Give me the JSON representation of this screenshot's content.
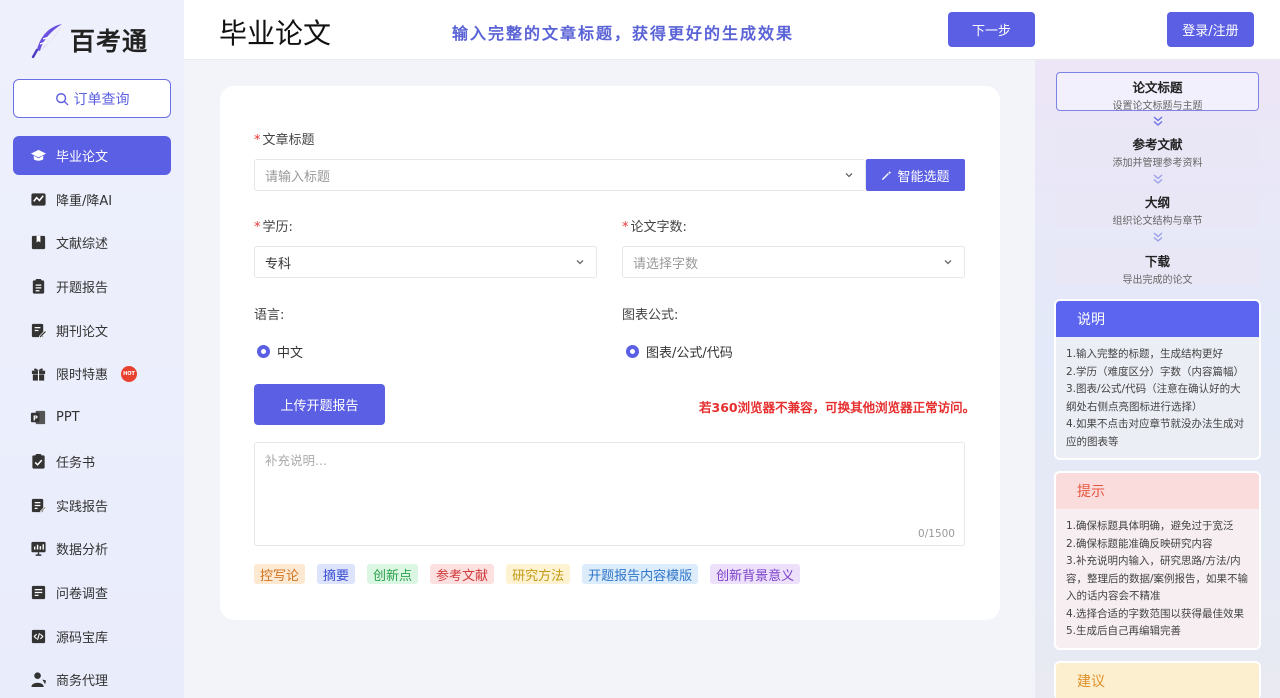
{
  "brand": {
    "name": "百考通"
  },
  "sidebar": {
    "order_query": "订单查询",
    "items": [
      {
        "label": "毕业论文",
        "icon": "graduation-cap-icon",
        "active": true
      },
      {
        "label": "降重/降AI",
        "icon": "chart-wave-icon"
      },
      {
        "label": "文献综述",
        "icon": "book-icon"
      },
      {
        "label": "开题报告",
        "icon": "clipboard-list-icon"
      },
      {
        "label": "期刊论文",
        "icon": "edit-document-icon"
      },
      {
        "label": "限时特惠",
        "icon": "gift-icon",
        "badge": "HOT"
      },
      {
        "label": "PPT",
        "icon": "powerpoint-icon"
      },
      {
        "label": "任务书",
        "icon": "clipboard-check-icon"
      },
      {
        "label": "实践报告",
        "icon": "report-edit-icon"
      },
      {
        "label": "数据分析",
        "icon": "bar-chart-icon"
      },
      {
        "label": "问卷调查",
        "icon": "survey-icon"
      },
      {
        "label": "源码宝库",
        "icon": "code-file-icon"
      },
      {
        "label": "商务代理",
        "icon": "user-tie-icon"
      }
    ]
  },
  "header": {
    "title": "毕业论文",
    "slogan": "输入完整的文章标题，获得更好的生成效果",
    "next_button": "下一步",
    "login_button": "登录/注册"
  },
  "form": {
    "title_label": "文章标题",
    "title_placeholder": "请输入标题",
    "smart_button": "智能选题",
    "degree_label": "学历:",
    "degree_value": "专科",
    "wordcount_label": "论文字数:",
    "wordcount_placeholder": "请选择字数",
    "language_label": "语言:",
    "language_option": "中文",
    "chart_label": "图表公式:",
    "chart_option": "图表/公式/代码",
    "upload_button": "上传开题报告",
    "warning": "若360浏览器不兼容，可换其他浏览器正常访问。",
    "supplement_placeholder": "补充说明...",
    "char_count": "0/1500",
    "tags": [
      {
        "label": "控写论",
        "bg": "#fde8d2",
        "color": "#d0721f"
      },
      {
        "label": "摘要",
        "bg": "#dde3fb",
        "color": "#3c4fd0"
      },
      {
        "label": "创新点",
        "bg": "#dcf6e4",
        "color": "#2aa24a"
      },
      {
        "label": "参考文献",
        "bg": "#fde0e0",
        "color": "#d03a3a"
      },
      {
        "label": "研究方法",
        "bg": "#fdf3d3",
        "color": "#c29a12"
      },
      {
        "label": "开题报告内容模版",
        "bg": "#ddecfb",
        "color": "#2e76c9"
      },
      {
        "label": "创新背景意义",
        "bg": "#ece0fb",
        "color": "#7a3fc9"
      }
    ]
  },
  "steps": [
    {
      "title": "论文标题",
      "desc": "设置论文标题与主题",
      "active": true
    },
    {
      "title": "参考文献",
      "desc": "添加并管理参考资料"
    },
    {
      "title": "大纲",
      "desc": "组织论文结构与章节"
    },
    {
      "title": "下载",
      "desc": "导出完成的论文"
    }
  ],
  "panels": {
    "explain": {
      "title": "说明",
      "lines": [
        "1.输入完整的标题，生成结构更好",
        "2.学历（难度区分）字数（内容篇幅）",
        "3.图表/公式/代码（注意在确认好的大纲处右侧点亮图标进行选择）",
        "4.如果不点击对应章节就没办法生成对应的图表等"
      ]
    },
    "tips": {
      "title": "提示",
      "lines": [
        "1.确保标题具体明确，避免过于宽泛",
        "2.确保标题能准确反映研究内容",
        "3.补充说明内输入，研究思路/方法/内容，整理后的数据/案例报告，如果不输入的话内容会不精准",
        "4.选择合适的字数范围以获得最佳效果",
        "5.生成后自己再编辑完善"
      ]
    },
    "suggest": {
      "title": "建议"
    }
  },
  "colors": {
    "accent": "#5b5fe3",
    "warning": "#e62f2f"
  }
}
